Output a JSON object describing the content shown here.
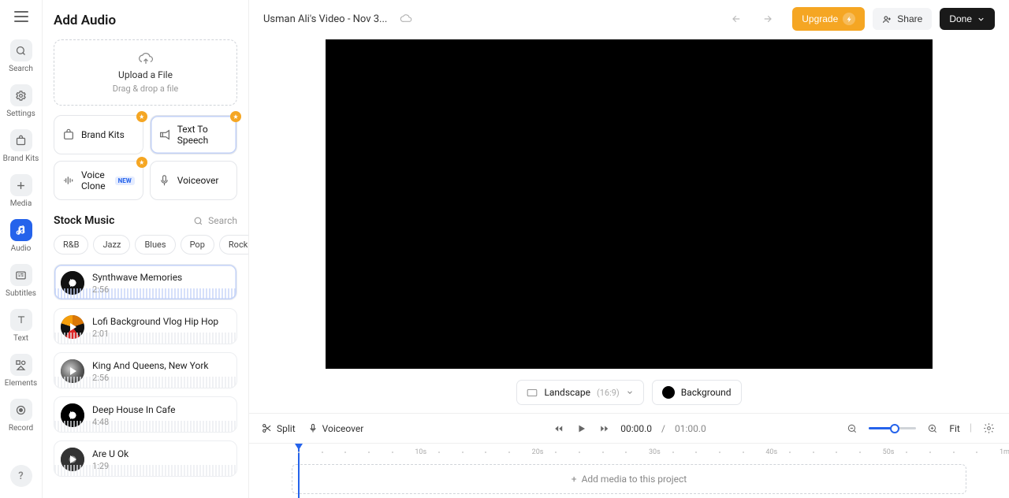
{
  "rail": {
    "items": [
      {
        "id": "search",
        "label": "Search"
      },
      {
        "id": "settings",
        "label": "Settings"
      },
      {
        "id": "brandkits",
        "label": "Brand Kits"
      },
      {
        "id": "media",
        "label": "Media"
      },
      {
        "id": "audio",
        "label": "Audio"
      },
      {
        "id": "subtitles",
        "label": "Subtitles"
      },
      {
        "id": "text",
        "label": "Text"
      },
      {
        "id": "elements",
        "label": "Elements"
      },
      {
        "id": "record",
        "label": "Record"
      }
    ],
    "active": "audio",
    "help": "?"
  },
  "panel": {
    "title": "Add Audio",
    "upload": {
      "title": "Upload a File",
      "sub": "Drag & drop a file"
    },
    "options": [
      {
        "id": "brandkits",
        "label": "Brand Kits",
        "badge": true
      },
      {
        "id": "tts",
        "label": "Text To Speech",
        "badge": true,
        "selected": true
      },
      {
        "id": "voiceclone",
        "label": "Voice Clone",
        "new": "NEW",
        "badge": true
      },
      {
        "id": "voiceover",
        "label": "Voiceover"
      }
    ],
    "stock": {
      "title": "Stock Music",
      "search_label": "Search",
      "genres": [
        "R&B",
        "Jazz",
        "Blues",
        "Pop",
        "Rock"
      ],
      "more": "•••",
      "tracks": [
        {
          "name": "Synthwave Memories",
          "dur": "2:56",
          "selected": true
        },
        {
          "name": "Lofi Background Vlog Hip Hop",
          "dur": "2:01"
        },
        {
          "name": "King And Queens, New York",
          "dur": "2:56"
        },
        {
          "name": "Deep House In Cafe",
          "dur": "4:48"
        },
        {
          "name": "Are U Ok",
          "dur": "1:29"
        }
      ]
    }
  },
  "topbar": {
    "project_name": "Usman Ali's Video - Nov 3...",
    "upgrade": "Upgrade",
    "share": "Share",
    "done": "Done"
  },
  "canvas": {
    "aspect_label": "Landscape",
    "aspect_ratio": "(16:9)",
    "background_label": "Background",
    "background_color": "#000000"
  },
  "bottom": {
    "split": "Split",
    "voiceover": "Voiceover",
    "current": "00:00.0",
    "sep": "/",
    "total": "01:00.0",
    "fit": "Fit"
  },
  "timeline": {
    "ticks": [
      "10s",
      "20s",
      "30s",
      "40s",
      "50s",
      "1m"
    ],
    "empty": "Add media to this project"
  }
}
